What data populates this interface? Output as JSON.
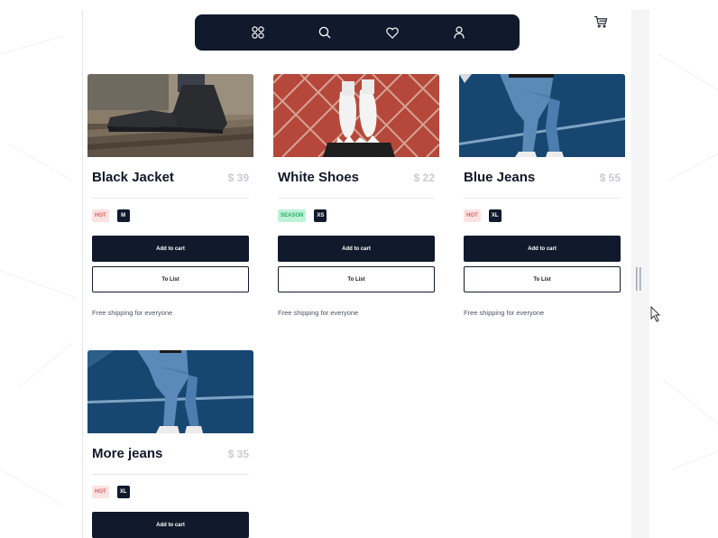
{
  "nav": {
    "icons": [
      "grid-icon",
      "search-icon",
      "heart-icon",
      "user-icon"
    ]
  },
  "cart": {
    "icon": "cart-icon"
  },
  "products": [
    {
      "title": "Black Jacket",
      "price": "$ 39",
      "tag": "HOT",
      "tag_type": "hot",
      "size": "M",
      "add_label": "Add to cart",
      "list_label": "To List",
      "shipping": "Free shipping for everyone",
      "image": "black-sneakers-on-bench"
    },
    {
      "title": "White Shoes",
      "price": "$ 22",
      "tag": "SEASON",
      "tag_type": "season",
      "size": "XS",
      "add_label": "Add to cart",
      "list_label": "To List",
      "shipping": "Free shipping for everyone",
      "image": "white-sneakers-on-brick"
    },
    {
      "title": "Blue Jeans",
      "price": "$ 55",
      "tag": "HOT",
      "tag_type": "hot",
      "size": "XL",
      "add_label": "Add to cart",
      "list_label": "To List",
      "shipping": "Free shipping for everyone",
      "image": "blue-jeans-legs"
    },
    {
      "title": "More jeans",
      "price": "$ 35",
      "tag": "HOT",
      "tag_type": "hot",
      "size": "XL",
      "add_label": "Add to cart",
      "image": "blue-jeans-legs"
    }
  ],
  "colors": {
    "navy": "#111a2c",
    "hot_bg": "#fde2e2",
    "hot_text": "#e25c5c",
    "season_bg": "#bdf2d6",
    "season_text": "#2fae6f",
    "price": "#c7ccd3"
  }
}
